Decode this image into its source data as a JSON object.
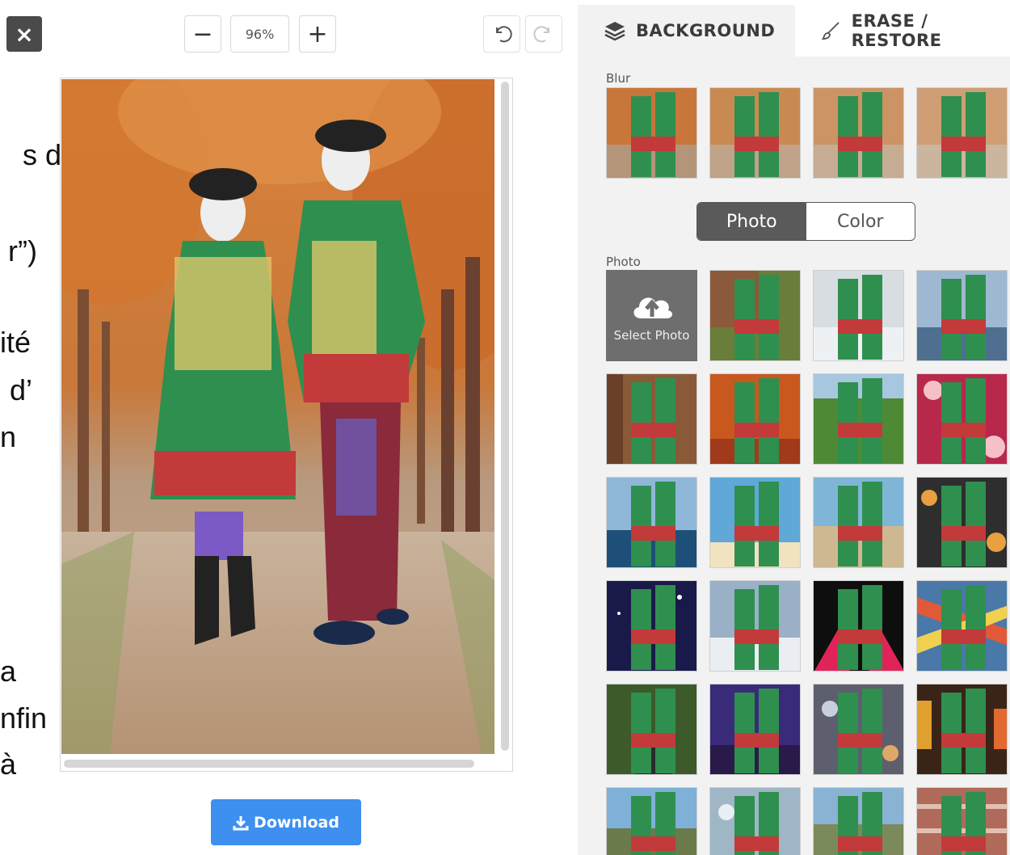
{
  "background_text": [
    "s d’",
    "r”)",
    "ité",
    "d’",
    "n",
    "a",
    "nfin",
    "à"
  ],
  "toolbar": {
    "close_icon": "×",
    "zoom_out_label": "−",
    "zoom_value": "96%",
    "zoom_in_label": "+"
  },
  "download": {
    "label": "Download"
  },
  "tabs": {
    "background": "BACKGROUND",
    "erase_restore": "ERASE / RESTORE"
  },
  "blur_section": {
    "label": "Blur"
  },
  "toggle": {
    "photo": "Photo",
    "color": "Color",
    "selected": "Photo"
  },
  "photo_section": {
    "label": "Photo",
    "select_photo": "Select Photo"
  },
  "colors": {
    "accent": "#3d8ff0",
    "panel_bg": "#f2f2f2",
    "toggle_active": "#5a5a5a"
  }
}
